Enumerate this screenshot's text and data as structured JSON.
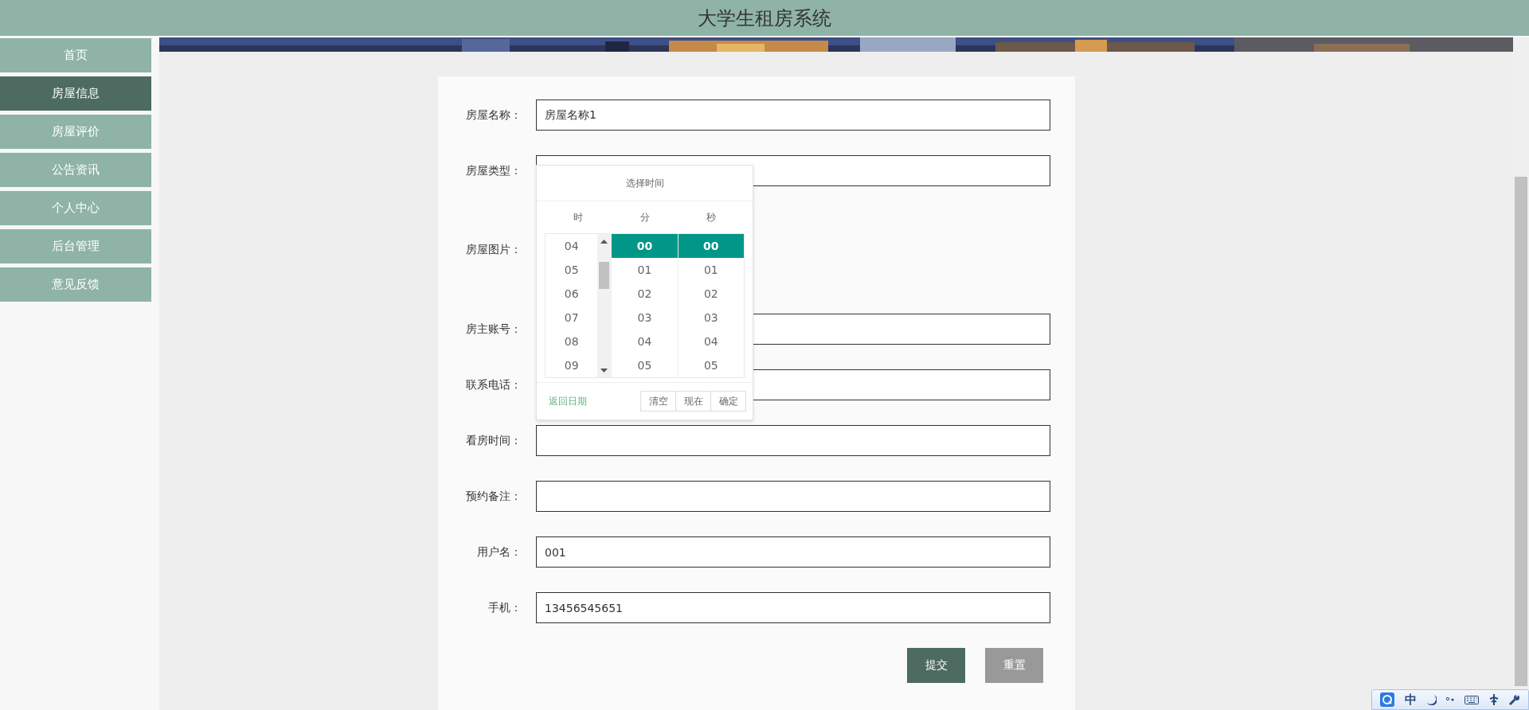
{
  "header": {
    "title": "大学生租房系统"
  },
  "sidebar": {
    "items": [
      {
        "label": "首页",
        "selected": false
      },
      {
        "label": "房屋信息",
        "selected": true
      },
      {
        "label": "房屋评价",
        "selected": false
      },
      {
        "label": "公告资讯",
        "selected": false
      },
      {
        "label": "个人中心",
        "selected": false
      },
      {
        "label": "后台管理",
        "selected": false
      },
      {
        "label": "意见反馈",
        "selected": false
      }
    ]
  },
  "form": {
    "fields": [
      {
        "label": "房屋名称：",
        "kind": "text",
        "value": "房屋名称1"
      },
      {
        "label": "房屋类型：",
        "kind": "text"
      },
      {
        "label": "房屋图片："
      },
      {
        "label": "房主账号：",
        "kind": "text"
      },
      {
        "label": "联系电话：",
        "kind": "text"
      },
      {
        "label": "看房时间：",
        "kind": "text"
      },
      {
        "label": "预约备注：",
        "kind": "text"
      },
      {
        "label": "用户名：",
        "kind": "text",
        "value": "001"
      },
      {
        "label": "手机：",
        "kind": "text",
        "value": "13456545651"
      }
    ],
    "buttons": [
      {
        "label": "提交",
        "kind": "primary"
      },
      {
        "label": "重置",
        "kind": "secondary"
      }
    ]
  },
  "time_picker": {
    "title": "选择时间",
    "columns": [
      {
        "header": "时",
        "options": [
          {
            "label": "04",
            "selected": false
          },
          {
            "label": "05",
            "selected": false
          },
          {
            "label": "06",
            "selected": false
          },
          {
            "label": "07",
            "selected": false
          },
          {
            "label": "08",
            "selected": false
          },
          {
            "label": "09",
            "selected": false
          }
        ]
      },
      {
        "header": "分",
        "options": [
          {
            "label": "00",
            "selected": true
          },
          {
            "label": "01",
            "selected": false
          },
          {
            "label": "02",
            "selected": false
          },
          {
            "label": "03",
            "selected": false
          },
          {
            "label": "04",
            "selected": false
          },
          {
            "label": "05",
            "selected": false
          }
        ]
      },
      {
        "header": "秒",
        "options": [
          {
            "label": "00",
            "selected": true
          },
          {
            "label": "01",
            "selected": false
          },
          {
            "label": "02",
            "selected": false
          },
          {
            "label": "03",
            "selected": false
          },
          {
            "label": "04",
            "selected": false
          },
          {
            "label": "05",
            "selected": false
          }
        ]
      }
    ],
    "back_link": "返回日期",
    "buttons": [
      "清空",
      "现在",
      "确定"
    ]
  },
  "ime_toolbar": {
    "mode": "中"
  }
}
